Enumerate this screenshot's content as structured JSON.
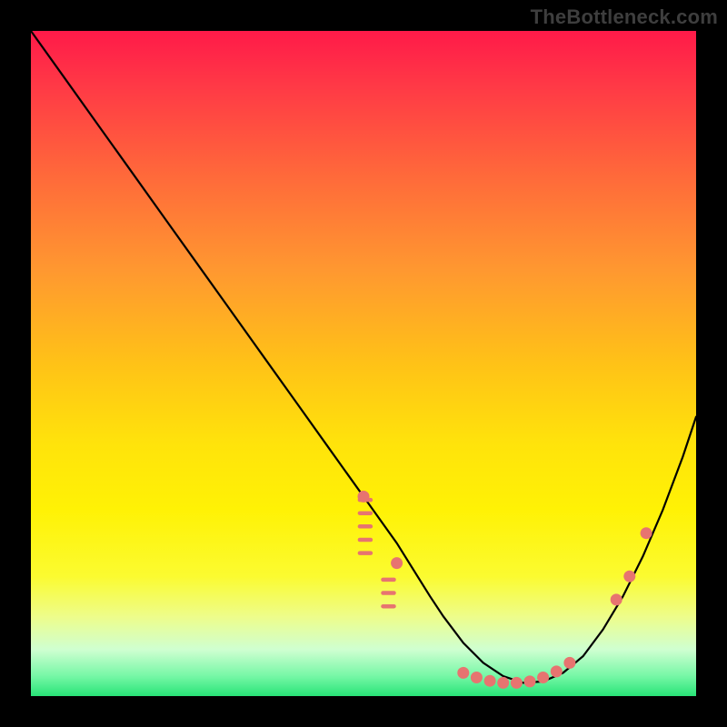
{
  "attribution": "TheBottleneck.com",
  "chart_data": {
    "type": "line",
    "title": "",
    "xlabel": "",
    "ylabel": "",
    "xlim": [
      0,
      100
    ],
    "ylim": [
      0,
      100
    ],
    "grid": false,
    "legend": false,
    "series": [
      {
        "name": "curve",
        "x": [
          0,
          5,
          10,
          15,
          20,
          25,
          30,
          35,
          40,
          45,
          50,
          55,
          60,
          62,
          65,
          68,
          71,
          74,
          77,
          80,
          83,
          86,
          89,
          92,
          95,
          98,
          100
        ],
        "y": [
          100,
          93,
          86,
          79,
          72,
          65,
          58,
          51,
          44,
          37,
          30,
          23,
          15,
          12,
          8,
          5,
          3,
          2,
          2.2,
          3.5,
          6,
          10,
          15,
          21,
          28,
          36,
          42
        ]
      }
    ],
    "markers": {
      "left_ticks_x": 50.8,
      "left_ticks_y": [
        29.5,
        27.5,
        25.5,
        23.5,
        21.5
      ],
      "ticks2_x": 54.3,
      "ticks2_y": [
        17.5,
        15.5,
        13.5
      ],
      "dots_on_curve": [
        {
          "x": 50,
          "y": 30
        },
        {
          "x": 55,
          "y": 20
        },
        {
          "x": 65,
          "y": 3.5
        },
        {
          "x": 67,
          "y": 2.8
        },
        {
          "x": 69,
          "y": 2.3
        },
        {
          "x": 71,
          "y": 2.0
        },
        {
          "x": 73,
          "y": 2.0
        },
        {
          "x": 75,
          "y": 2.2
        },
        {
          "x": 77,
          "y": 2.8
        },
        {
          "x": 79,
          "y": 3.7
        },
        {
          "x": 81,
          "y": 5.0
        },
        {
          "x": 88,
          "y": 14.5
        },
        {
          "x": 90,
          "y": 18.0
        },
        {
          "x": 92.5,
          "y": 24.5
        }
      ]
    },
    "colors": {
      "curve": "#000000",
      "markers": "#e77470",
      "gradient_top": "#ff1a49",
      "gradient_bottom": "#28e477"
    }
  }
}
